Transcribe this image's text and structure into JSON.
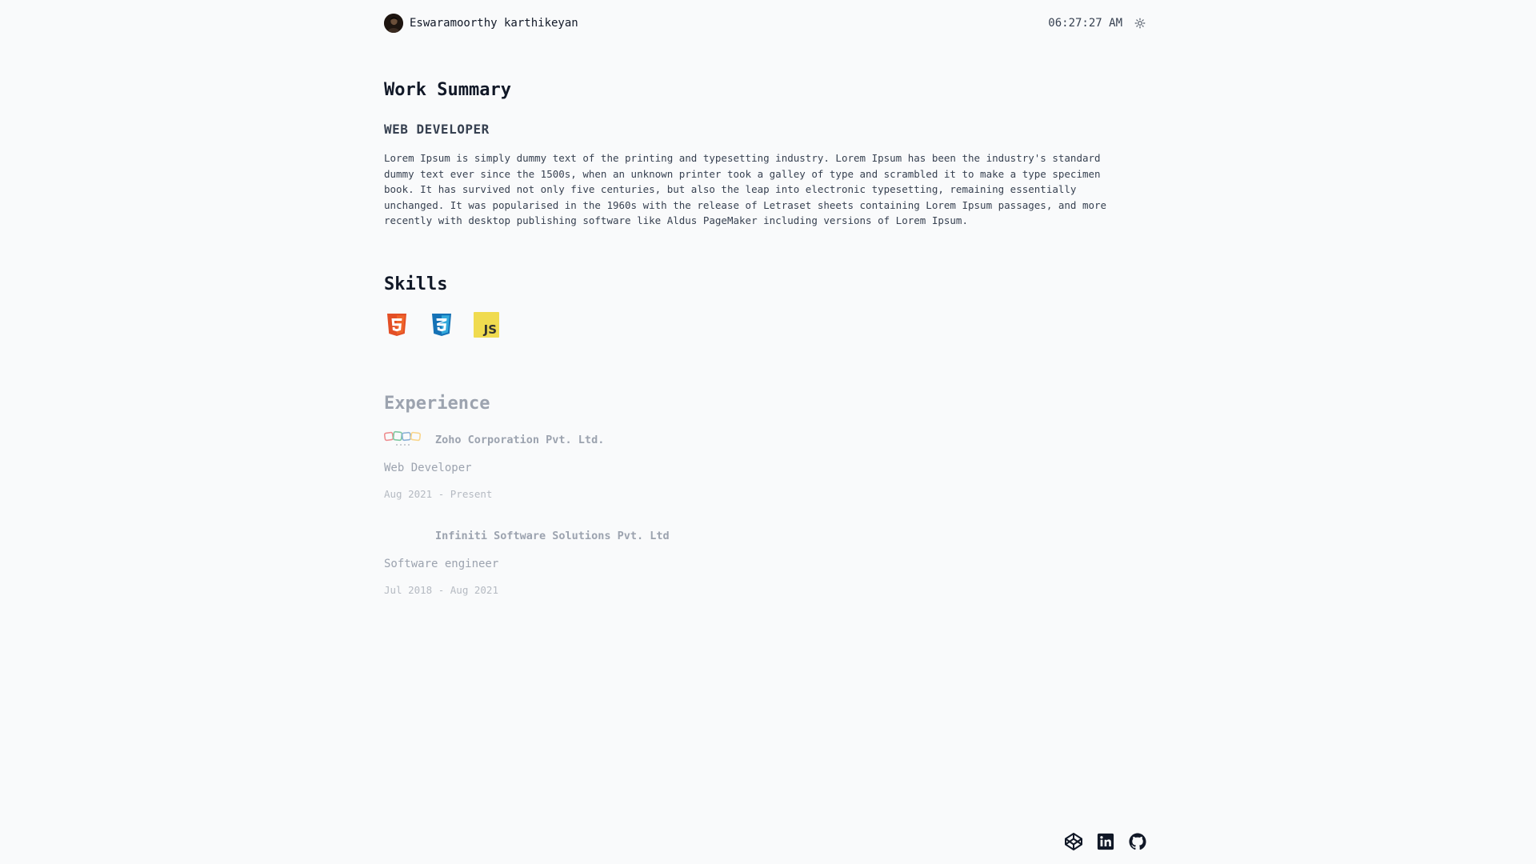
{
  "header": {
    "name": "Eswaramoorthy karthikeyan",
    "time": "06:27:27 AM"
  },
  "work_summary": {
    "title": "Work Summary",
    "role": "WEB DEVELOPER",
    "description": "Lorem Ipsum is simply dummy text of the printing and typesetting industry. Lorem Ipsum has been the industry's standard dummy text ever since the 1500s, when an unknown printer took a galley of type and scrambled it to make a type specimen book. It has survived not only five centuries, but also the leap into electronic typesetting, remaining essentially unchanged. It was popularised in the 1960s with the release of Letraset sheets containing Lorem Ipsum passages, and more recently with desktop publishing software like Aldus PageMaker including versions of Lorem Ipsum."
  },
  "skills": {
    "title": "Skills",
    "items": [
      {
        "icon": "html5-icon",
        "color": "#e34f26"
      },
      {
        "icon": "css3-icon",
        "color": "#1572b6"
      },
      {
        "icon": "javascript-icon",
        "color": "#f7df1e",
        "label": "JS"
      }
    ]
  },
  "experience": {
    "title": "Experience",
    "jobs": [
      {
        "company": "Zoho Corporation Pvt. Ltd.",
        "role": "Web Developer",
        "period": "Aug 2021 - Present",
        "logo": "zoho-logo"
      },
      {
        "company": "Infiniti Software Solutions Pvt. Ltd",
        "role": "Software engineer",
        "period": "Jul 2018 - Aug 2021",
        "logo": "infiniti-logo"
      }
    ]
  },
  "footer": {
    "links": [
      {
        "icon": "codepen-icon"
      },
      {
        "icon": "linkedin-icon"
      },
      {
        "icon": "github-icon"
      }
    ]
  },
  "colors": {
    "background": "#f9fafb",
    "text": "#1f2937",
    "muted": "#9ca3af"
  }
}
